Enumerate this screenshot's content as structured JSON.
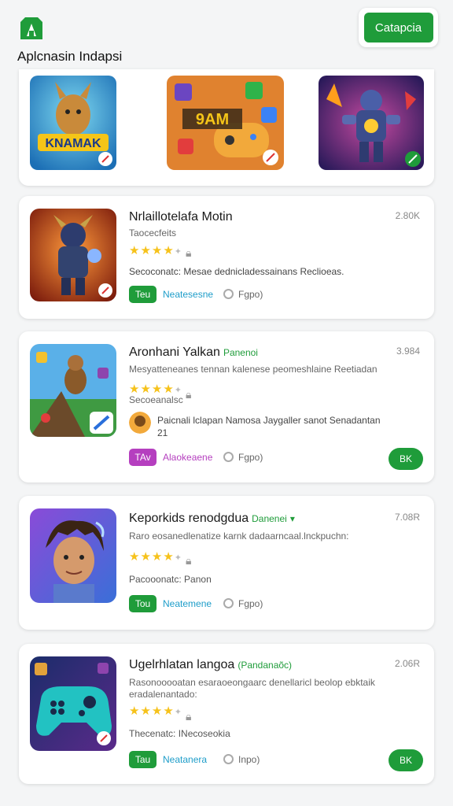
{
  "header": {
    "title": "Aplcnasin Indapsi",
    "top_button": "Catapcia",
    "accent": "#1f9c3a"
  },
  "featured": {
    "items": [
      {
        "name": "featured-game-1",
        "art": "KNAMAK"
      },
      {
        "name": "featured-game-2",
        "art": "9AM"
      },
      {
        "name": "featured-game-3",
        "art": ""
      }
    ]
  },
  "apps": [
    {
      "title": "Nrlaillotelafa Motin",
      "badge": "",
      "size": "2.80K",
      "subtitle": "Taocecfeits",
      "rating": 4,
      "description": "Secoconatc: Mesae dednicladessainans Reclioeas.",
      "tag": "Teu",
      "link": "Neatesesne",
      "meta": "Fgpo)"
    },
    {
      "title": "Aronhani Yalkan",
      "badge": "Panenoi",
      "size": "3.984",
      "subtitle": "Mesyatteneanes tennan kalenese peomeshlaine Reetiadan",
      "rating": 4,
      "description": "Secoeanalsc",
      "review": "Paicnali lclapan Namosa Jaygaller sanot Senadantan",
      "review_count": "21",
      "tag": "TAv",
      "link": "Alaokeaene",
      "meta": "Fgpo)",
      "button": "BK"
    },
    {
      "title": "Keporkids renodgdua",
      "badge": "Danenei",
      "size": "7.08R",
      "subtitle": "Raro eosanedlenatize karnk dadaarncaal.lnckpuchn:",
      "rating": 4,
      "description": "Pacooonatc: Panon",
      "tag": "Tou",
      "link": "Neatemene",
      "meta": "Fgpo)"
    },
    {
      "title": "Ugelrhlatan langoa",
      "badge": "(Pandanaõc)",
      "size": "2.06R",
      "subtitle": "Rasonooooatan esaraoeongaarc denellaricl beolop ebktaik",
      "subtitle2": "eradalenantado:",
      "rating": 4,
      "description": "Thecenatc: INecoseokia",
      "tag": "Tau",
      "link": "Neatanera",
      "meta": "Inpo)",
      "button": "BK"
    }
  ]
}
